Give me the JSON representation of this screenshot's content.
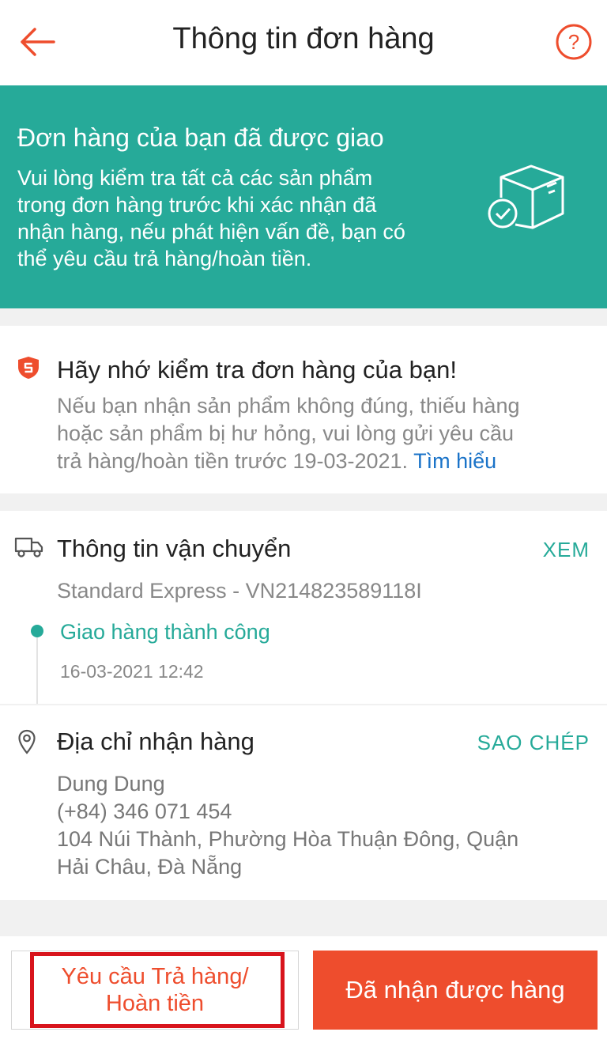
{
  "header": {
    "title": "Thông tin đơn hàng",
    "back_icon": "arrow-left-icon",
    "help_icon": "question-circle-icon"
  },
  "banner": {
    "title": "Đơn hàng của bạn đã được giao",
    "line1": "Vui lòng kiểm tra tất cả các sản phẩm",
    "line2": "trong đơn hàng trước khi xác nhận đã",
    "line3": "nhận hàng, nếu phát hiện vấn đề, bạn có",
    "line4": "thể yêu cầu trả hàng/hoàn tiền.",
    "icon": "package-check-icon"
  },
  "reminder": {
    "title": "Hãy nhớ kiểm tra đơn hàng của bạn!",
    "line1": "Nếu bạn nhận sản phẩm không đúng, thiếu hàng",
    "line2": "hoặc sản phẩm bị hư hỏng, vui lòng gửi yêu cầu",
    "line3": "trả hàng/hoàn tiền trước 19-03-2021.",
    "link": "Tìm hiểu",
    "icon": "shield-icon"
  },
  "shipping": {
    "title": "Thông tin vận chuyển",
    "action": "XEM",
    "carrier": "Standard Express - VN214823589118I",
    "status": "Giao hàng thành công",
    "time": "16-03-2021 12:42",
    "icon": "truck-icon"
  },
  "address": {
    "title": "Địa chỉ nhận hàng",
    "action": "SAO CHÉP",
    "name": "Dung Dung",
    "phone": "(+84) 346 071 454",
    "line1": "104 Núi Thành, Phường Hòa Thuận Đông, Quận",
    "line2": "Hải Châu, Đà Nẵng",
    "icon": "map-pin-icon"
  },
  "actions": {
    "return_line1": "Yêu cầu Trả hàng/",
    "return_line2": "Hoàn tiền",
    "received": "Đã nhận được hàng"
  },
  "colors": {
    "primary": "#ee4d2d",
    "teal": "#26aa99",
    "highlight": "#d8141c"
  }
}
